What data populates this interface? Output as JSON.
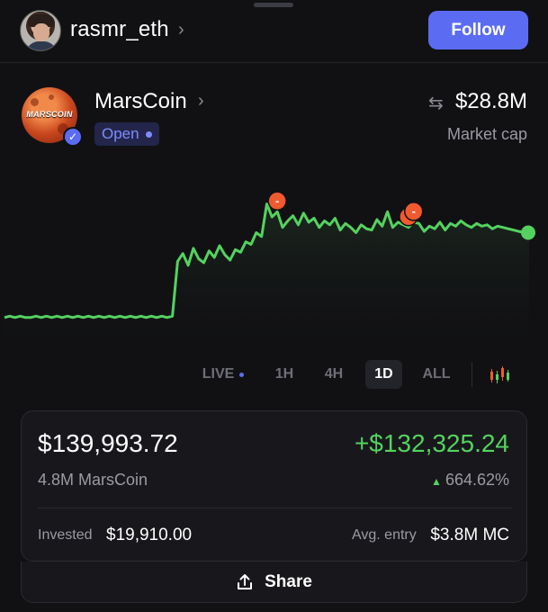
{
  "header": {
    "username": "rasmr_eth",
    "follow_label": "Follow"
  },
  "token": {
    "name": "MarsCoin",
    "logo_text": "MARSCOIN",
    "status": "Open",
    "market_cap": "$28.8M",
    "market_cap_label": "Market cap"
  },
  "chart_data": {
    "type": "line",
    "title": "",
    "xlabel": "",
    "ylabel": "",
    "grid": false,
    "line_color": "#54d25f",
    "marker_color": "#f05a2e",
    "markers": [
      {
        "label": "-",
        "index": 52
      },
      {
        "label": "-",
        "index": 77
      },
      {
        "label": "-",
        "index": 78
      }
    ],
    "y": [
      0.05,
      0.06,
      0.05,
      0.06,
      0.05,
      0.05,
      0.06,
      0.05,
      0.06,
      0.05,
      0.06,
      0.05,
      0.06,
      0.05,
      0.06,
      0.05,
      0.06,
      0.05,
      0.06,
      0.05,
      0.06,
      0.05,
      0.06,
      0.05,
      0.06,
      0.05,
      0.06,
      0.05,
      0.06,
      0.05,
      0.06,
      0.05,
      0.06,
      0.48,
      0.54,
      0.45,
      0.58,
      0.5,
      0.47,
      0.56,
      0.51,
      0.6,
      0.53,
      0.49,
      0.57,
      0.55,
      0.63,
      0.61,
      0.7,
      0.67,
      0.92,
      0.82,
      0.86,
      0.74,
      0.79,
      0.83,
      0.76,
      0.85,
      0.78,
      0.81,
      0.74,
      0.79,
      0.76,
      0.81,
      0.72,
      0.77,
      0.74,
      0.7,
      0.76,
      0.73,
      0.72,
      0.8,
      0.75,
      0.86,
      0.74,
      0.78,
      0.76,
      0.74,
      0.78,
      0.77,
      0.71,
      0.75,
      0.73,
      0.78,
      0.72,
      0.77,
      0.75,
      0.79,
      0.76,
      0.74,
      0.77,
      0.75,
      0.76,
      0.73,
      0.75,
      0.74,
      0.73,
      0.72,
      0.71,
      0.7,
      0.7
    ],
    "end_point_color": "#54d25f"
  },
  "timeframes": {
    "items": [
      "LIVE",
      "1H",
      "4H",
      "1D",
      "ALL"
    ],
    "selected": "1D"
  },
  "position": {
    "value": "$139,993.72",
    "pnl": "+$132,325.24",
    "holdings": "4.8M MarsCoin",
    "pnl_pct": "664.62%",
    "invested_label": "Invested",
    "invested_value": "$19,910.00",
    "entry_label": "Avg. entry",
    "entry_value": "$3.8M MC"
  },
  "share_label": "Share",
  "colors": {
    "accent": "#5b6cf3",
    "positive": "#54d25f",
    "marker": "#f05a2e"
  }
}
